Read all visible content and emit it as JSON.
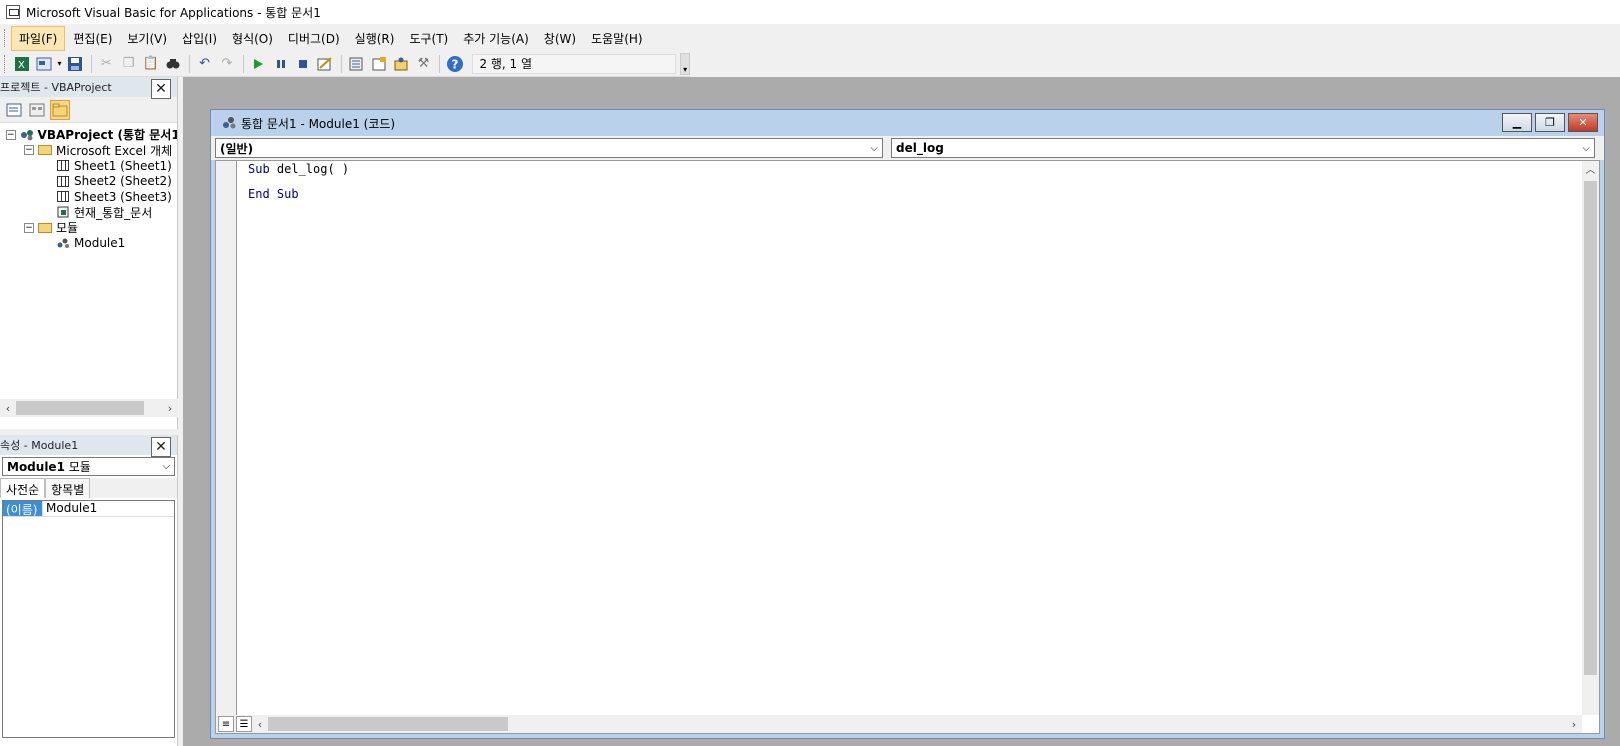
{
  "window": {
    "title": "Microsoft Visual Basic for Applications - 통합 문서1"
  },
  "menu": [
    "파일(F)",
    "편집(E)",
    "보기(V)",
    "삽입(I)",
    "형식(O)",
    "디버그(D)",
    "실행(R)",
    "도구(T)",
    "추가 기능(A)",
    "창(W)",
    "도움말(H)"
  ],
  "toolbar": {
    "position_text": "2 행, 1 열"
  },
  "project": {
    "header": "프로젝트 - VBAProject",
    "tree": {
      "root": "VBAProject (통합 문서1)",
      "excel_objects": "Microsoft Excel 개체",
      "sheet1": "Sheet1 (Sheet1)",
      "sheet2": "Sheet2 (Sheet2)",
      "sheet3": "Sheet3 (Sheet3)",
      "workbook": "현재_통합_문서",
      "modules": "모듈",
      "module1": "Module1"
    }
  },
  "properties": {
    "header": "속성 - Module1",
    "object_name": "Module1",
    "object_type": "모듈",
    "tabs": [
      "사전순",
      "항목별"
    ],
    "rows": [
      {
        "name": "(이름)",
        "value": "Module1"
      }
    ]
  },
  "code_window": {
    "title": "통합 문서1 - Module1 (코드)",
    "object_combo": "(일반)",
    "procedure_combo": "del_log",
    "lines": {
      "l1_kw": "Sub",
      "l1_rest": " del_log( )",
      "l2_kw": "End Sub"
    }
  },
  "colors": {
    "selection": "#3c8edb",
    "keyword": "#00008b",
    "mdi_background": "#ababab"
  }
}
